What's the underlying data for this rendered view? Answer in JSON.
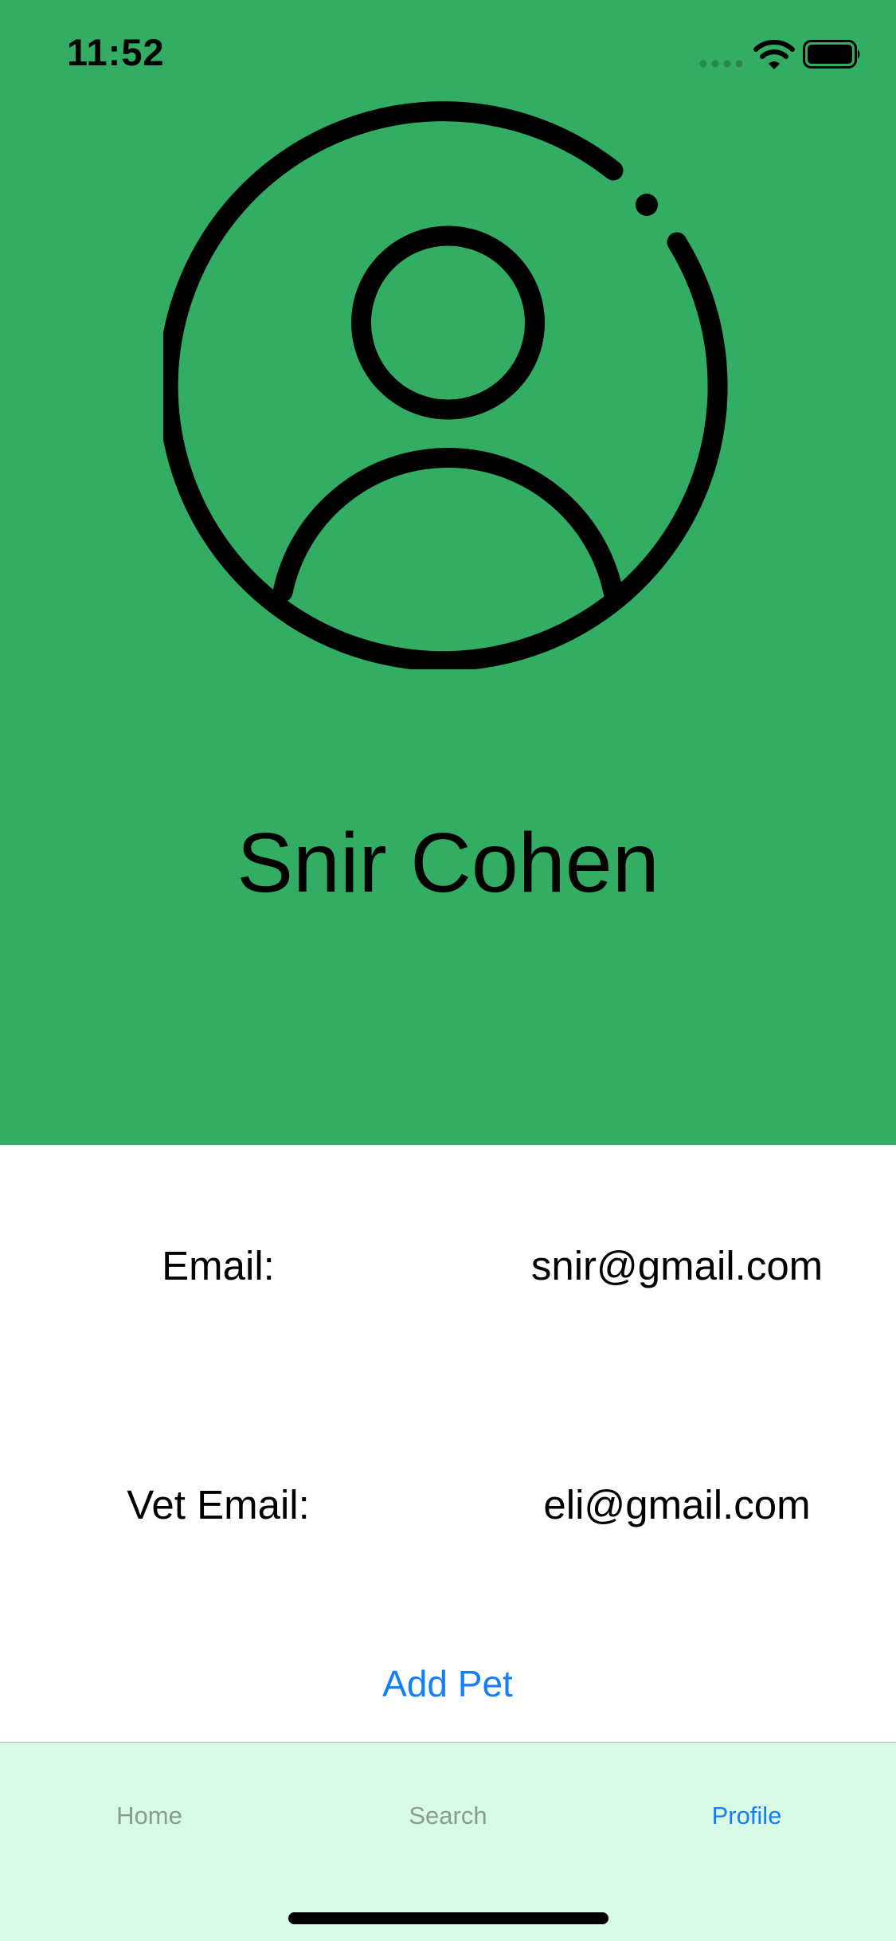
{
  "status_bar": {
    "time": "11:52",
    "icons": [
      "signal-icon",
      "wifi-icon",
      "battery-icon"
    ]
  },
  "header": {
    "background_color": "#33ad64",
    "avatar_icon": "user-circle-icon",
    "name": "Snir Cohen"
  },
  "info": {
    "email_label": "Email:",
    "email_value": "snir@gmail.com",
    "vet_email_label": "Vet Email:",
    "vet_email_value": "eli@gmail.com"
  },
  "actions": {
    "add_pet_label": "Add Pet",
    "link_color": "#147efb"
  },
  "tab_bar": {
    "background_color": "#d8f9e5",
    "items": [
      {
        "label": "Home",
        "selected": false
      },
      {
        "label": "Search",
        "selected": false
      },
      {
        "label": "Profile",
        "selected": true
      }
    ]
  }
}
